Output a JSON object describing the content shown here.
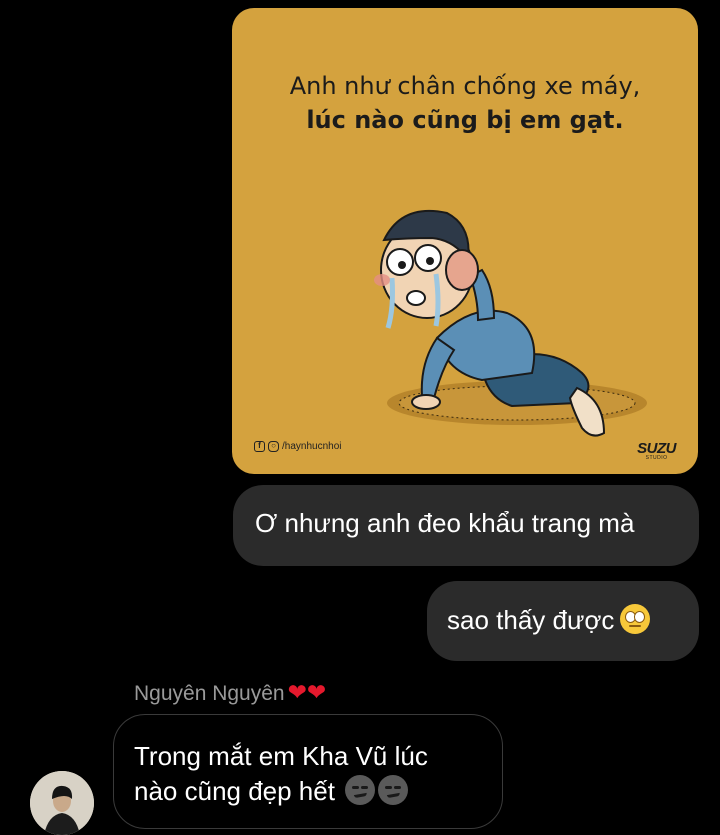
{
  "image_message": {
    "line1": "Anh như chân chống xe máy,",
    "line2": "lúc nào cũng bị em gạt.",
    "credit_handle": "/haynhucnhoi",
    "brand_name": "SUZU",
    "brand_sub": "STUDIO",
    "background_color": "#d4a23e"
  },
  "messages_out": [
    {
      "text": "Ơ nhưng anh đeo khẩu trang mà"
    },
    {
      "text": "sao thấy được",
      "emoji": "eye-roll-emoji"
    }
  ],
  "message_in": {
    "sender_name": "Nguyên Nguyên",
    "sender_hearts": "❤❤",
    "text_line1": "Trong mắt em Kha Vũ lúc",
    "text_line2": "nào cũng đẹp hết",
    "emoji": "smirk-emoji"
  },
  "colors": {
    "background": "#000000",
    "bubble_out": "#2b2b2b",
    "bubble_in_border": "#3a3a3a",
    "sender_name": "#9a9a9a",
    "heart": "#e5192d"
  }
}
